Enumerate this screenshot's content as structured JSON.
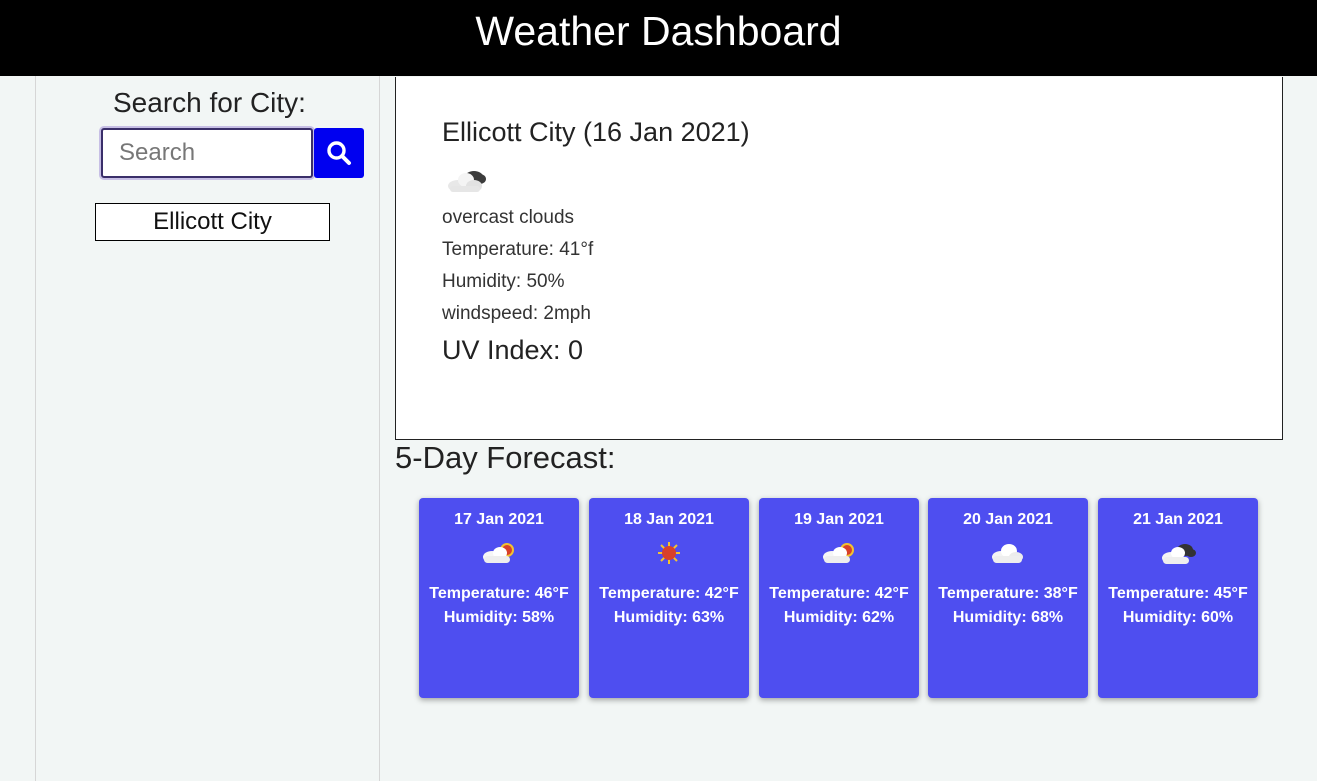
{
  "header": {
    "title": "Weather Dashboard"
  },
  "sidebar": {
    "search_title": "Search for City:",
    "search_placeholder": "Search",
    "search_value": "",
    "history": [
      "Ellicott City"
    ]
  },
  "current": {
    "city_date": "Ellicott City (16 Jan 2021)",
    "icon": "overcast-clouds-icon",
    "description": "overcast clouds",
    "temperature": "Temperature: 41°f",
    "humidity": "Humidity: 50%",
    "windspeed": "windspeed: 2mph",
    "uv": "UV Index: 0"
  },
  "forecast": {
    "title": "5-Day Forecast:",
    "days": [
      {
        "date": "17 Jan 2021",
        "icon": "few-clouds-icon",
        "temp": "Temperature: 46°F",
        "humidity": "Humidity: 58%"
      },
      {
        "date": "18 Jan 2021",
        "icon": "clear-sky-icon",
        "temp": "Temperature: 42°F",
        "humidity": "Humidity: 63%"
      },
      {
        "date": "19 Jan 2021",
        "icon": "few-clouds-icon",
        "temp": "Temperature: 42°F",
        "humidity": "Humidity: 62%"
      },
      {
        "date": "20 Jan 2021",
        "icon": "scattered-clouds-icon",
        "temp": "Temperature: 38°F",
        "humidity": "Humidity: 68%"
      },
      {
        "date": "21 Jan 2021",
        "icon": "broken-clouds-icon",
        "temp": "Temperature: 45°F",
        "humidity": "Humidity: 60%"
      }
    ]
  },
  "colors": {
    "header_bg": "#000000",
    "search_button": "#0000f0",
    "card_bg": "#4e4ef0",
    "page_bg": "#f2f6f5"
  }
}
